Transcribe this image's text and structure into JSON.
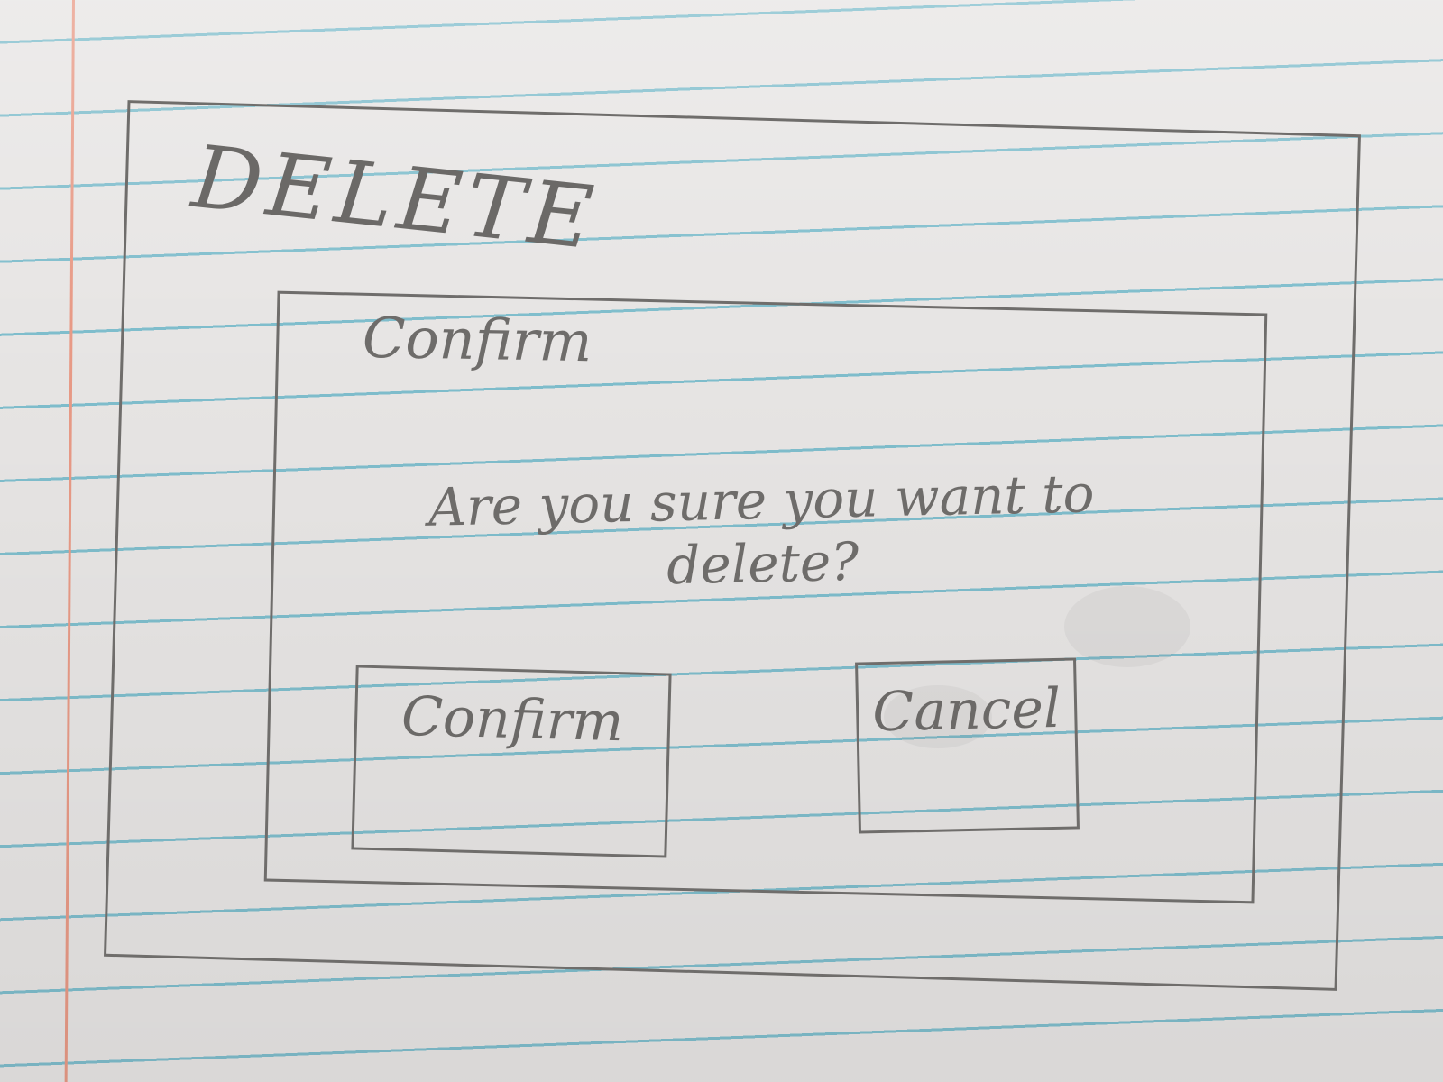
{
  "window": {
    "title": "DELETE"
  },
  "dialog": {
    "title": "Confirm",
    "message": "Are you sure you want to delete?",
    "buttons": {
      "confirm": "Confirm",
      "cancel": "Cancel"
    }
  },
  "colors": {
    "pencil": "#6f6d6b",
    "paper": "#e7e5e4",
    "rule_line": "#5cb0c4",
    "margin_line": "#e89a86"
  }
}
